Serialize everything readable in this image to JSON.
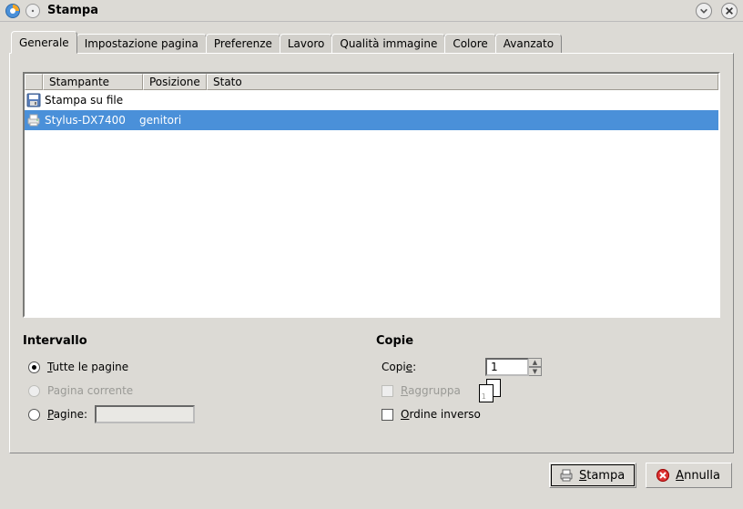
{
  "window": {
    "title": "Stampa"
  },
  "tabs": {
    "t0": "Generale",
    "t1": "Impostazione pagina",
    "t2": "Preferenze",
    "t3": "Lavoro",
    "t4": "Qualità immagine",
    "t5": "Colore",
    "t6": "Avanzato"
  },
  "printer_table": {
    "headers": {
      "name": "Stampante",
      "location": "Posizione",
      "state": "Stato"
    },
    "rows": [
      {
        "name": "Stampa su file",
        "location": "",
        "state": "",
        "icon": "save",
        "selected": false
      },
      {
        "name": "Stylus-DX7400",
        "location": "genitori",
        "state": "",
        "icon": "printer",
        "selected": true
      }
    ]
  },
  "range": {
    "heading": "Intervallo",
    "all": "Tutte le pagine",
    "current": "Pagina corrente",
    "pages": "Pagine:",
    "pages_value": ""
  },
  "copies": {
    "heading": "Copie",
    "label": "Copie:",
    "value": "1",
    "collate": "Raggruppa",
    "reverse": "Ordine inverso"
  },
  "buttons": {
    "print": "Stampa",
    "cancel": "Annulla"
  }
}
